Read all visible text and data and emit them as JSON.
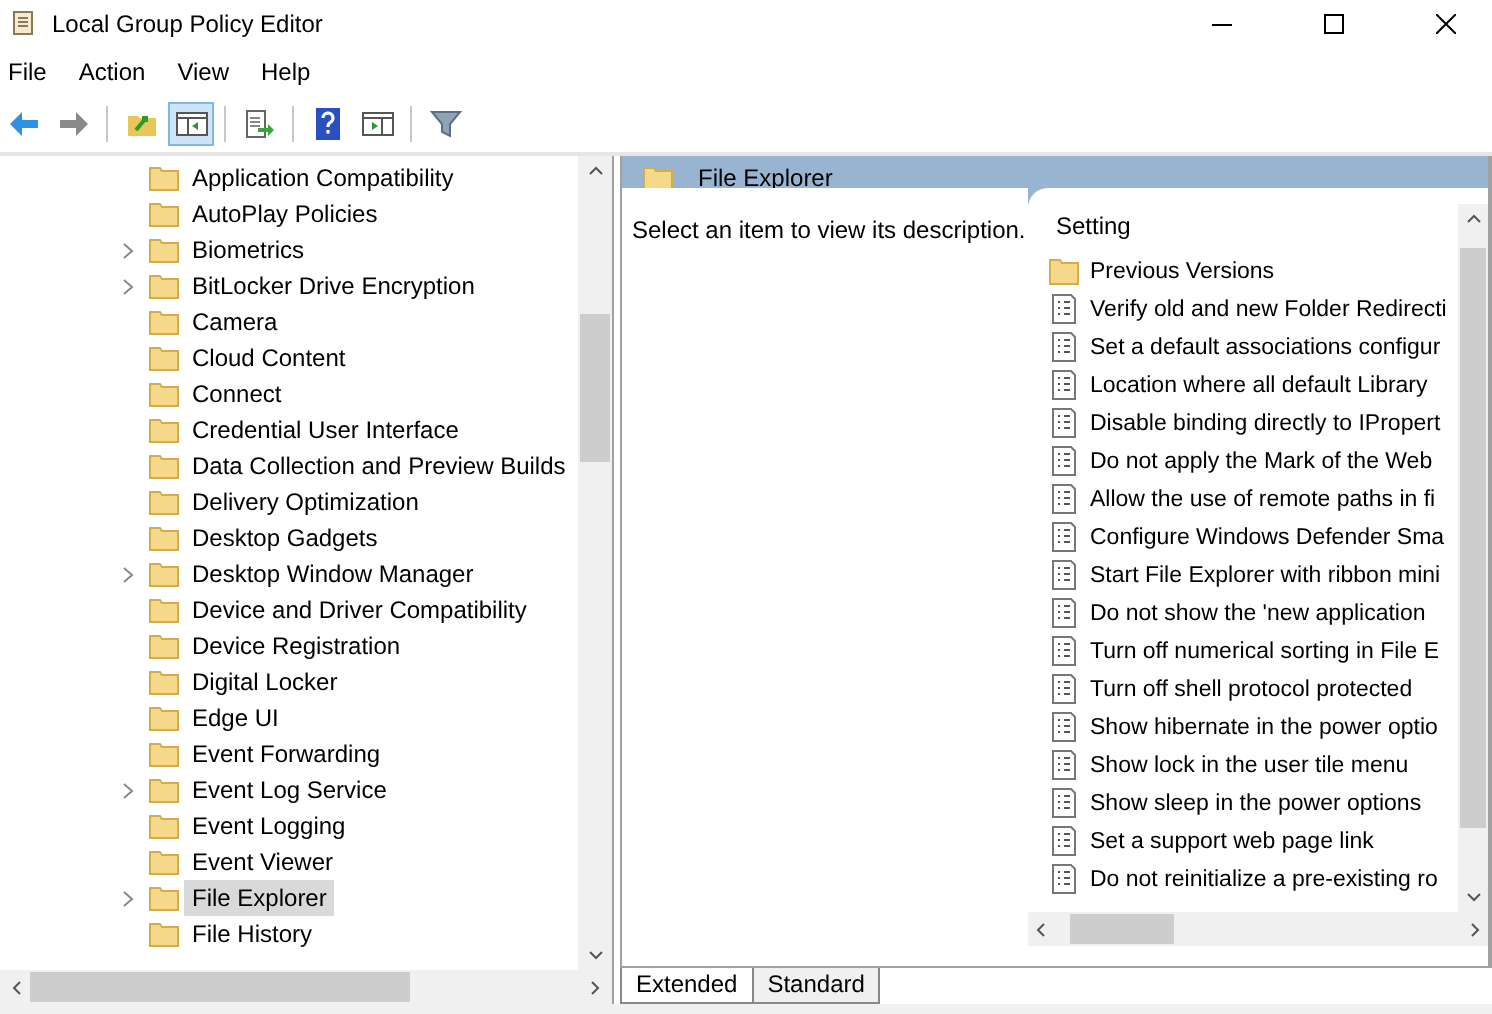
{
  "window": {
    "title": "Local Group Policy Editor"
  },
  "menu": [
    "File",
    "Action",
    "View",
    "Help"
  ],
  "toolbar": {
    "groups": [
      [
        {
          "kind": "back",
          "pressed": false
        },
        {
          "kind": "forward",
          "pressed": false
        }
      ],
      [
        {
          "kind": "up",
          "pressed": false
        },
        {
          "kind": "tree",
          "pressed": true
        }
      ],
      [
        {
          "kind": "export",
          "pressed": false
        }
      ],
      [
        {
          "kind": "help",
          "pressed": false
        },
        {
          "kind": "pane",
          "pressed": false
        }
      ],
      [
        {
          "kind": "filter",
          "pressed": false
        }
      ]
    ]
  },
  "tree": {
    "items": [
      {
        "label": "Application Compatibility",
        "expandable": false,
        "selected": false
      },
      {
        "label": "AutoPlay Policies",
        "expandable": false,
        "selected": false
      },
      {
        "label": "Biometrics",
        "expandable": true,
        "selected": false
      },
      {
        "label": "BitLocker Drive Encryption",
        "expandable": true,
        "selected": false
      },
      {
        "label": "Camera",
        "expandable": false,
        "selected": false
      },
      {
        "label": "Cloud Content",
        "expandable": false,
        "selected": false
      },
      {
        "label": "Connect",
        "expandable": false,
        "selected": false
      },
      {
        "label": "Credential User Interface",
        "expandable": false,
        "selected": false
      },
      {
        "label": "Data Collection and Preview Builds",
        "expandable": false,
        "selected": false
      },
      {
        "label": "Delivery Optimization",
        "expandable": false,
        "selected": false
      },
      {
        "label": "Desktop Gadgets",
        "expandable": false,
        "selected": false
      },
      {
        "label": "Desktop Window Manager",
        "expandable": true,
        "selected": false
      },
      {
        "label": "Device and Driver Compatibility",
        "expandable": false,
        "selected": false
      },
      {
        "label": "Device Registration",
        "expandable": false,
        "selected": false
      },
      {
        "label": "Digital Locker",
        "expandable": false,
        "selected": false
      },
      {
        "label": "Edge UI",
        "expandable": false,
        "selected": false
      },
      {
        "label": "Event Forwarding",
        "expandable": false,
        "selected": false
      },
      {
        "label": "Event Log Service",
        "expandable": true,
        "selected": false
      },
      {
        "label": "Event Logging",
        "expandable": false,
        "selected": false
      },
      {
        "label": "Event Viewer",
        "expandable": false,
        "selected": false
      },
      {
        "label": "File Explorer",
        "expandable": true,
        "selected": true
      },
      {
        "label": "File History",
        "expandable": false,
        "selected": false
      }
    ]
  },
  "details": {
    "title": "File Explorer",
    "description": "Select an item to view its description.",
    "column": "Setting",
    "items": [
      {
        "kind": "folder",
        "label": "Previous Versions"
      },
      {
        "kind": "setting",
        "label": "Verify old and new Folder Redirecti"
      },
      {
        "kind": "setting",
        "label": "Set a default associations configur"
      },
      {
        "kind": "setting",
        "label": "Location where all default Library"
      },
      {
        "kind": "setting",
        "label": "Disable binding directly to IPropert"
      },
      {
        "kind": "setting",
        "label": "Do not apply the Mark of the Web"
      },
      {
        "kind": "setting",
        "label": "Allow the use of remote paths in fi"
      },
      {
        "kind": "setting",
        "label": "Configure Windows Defender Sma"
      },
      {
        "kind": "setting",
        "label": "Start File Explorer with ribbon mini"
      },
      {
        "kind": "setting",
        "label": "Do not show the 'new application"
      },
      {
        "kind": "setting",
        "label": "Turn off numerical sorting in File E"
      },
      {
        "kind": "setting",
        "label": "Turn off shell protocol protected"
      },
      {
        "kind": "setting",
        "label": "Show hibernate in the power optio"
      },
      {
        "kind": "setting",
        "label": "Show lock in the user tile menu"
      },
      {
        "kind": "setting",
        "label": "Show sleep in the power options"
      },
      {
        "kind": "setting",
        "label": "Set a support web page link"
      },
      {
        "kind": "setting",
        "label": "Do not reinitialize a pre-existing ro"
      }
    ]
  },
  "tabs": [
    {
      "label": "Extended",
      "selected": true
    },
    {
      "label": "Standard",
      "selected": false
    }
  ]
}
